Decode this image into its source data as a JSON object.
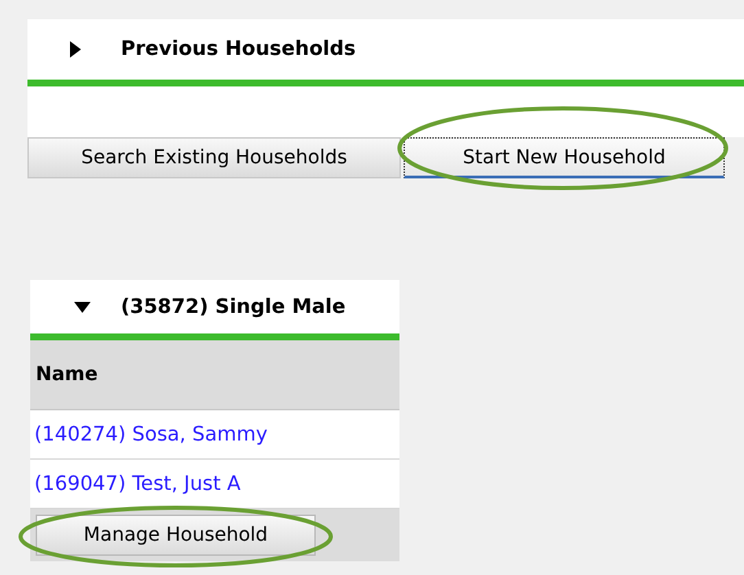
{
  "previous_panel": {
    "title": "Previous Households",
    "expanded": false
  },
  "buttons": [
    {
      "label": "Search Existing Households",
      "selected": false,
      "circled": false
    },
    {
      "label": "Start New Household",
      "selected": true,
      "circled": true
    }
  ],
  "household_panel": {
    "title": "(35872) Single Male",
    "expanded": true,
    "column": "Name",
    "rows": [
      {
        "name": "(140274) Sosa, Sammy"
      },
      {
        "name": "(169047) Test, Just A"
      }
    ],
    "button": {
      "label": "Manage Household",
      "circled": true
    }
  }
}
